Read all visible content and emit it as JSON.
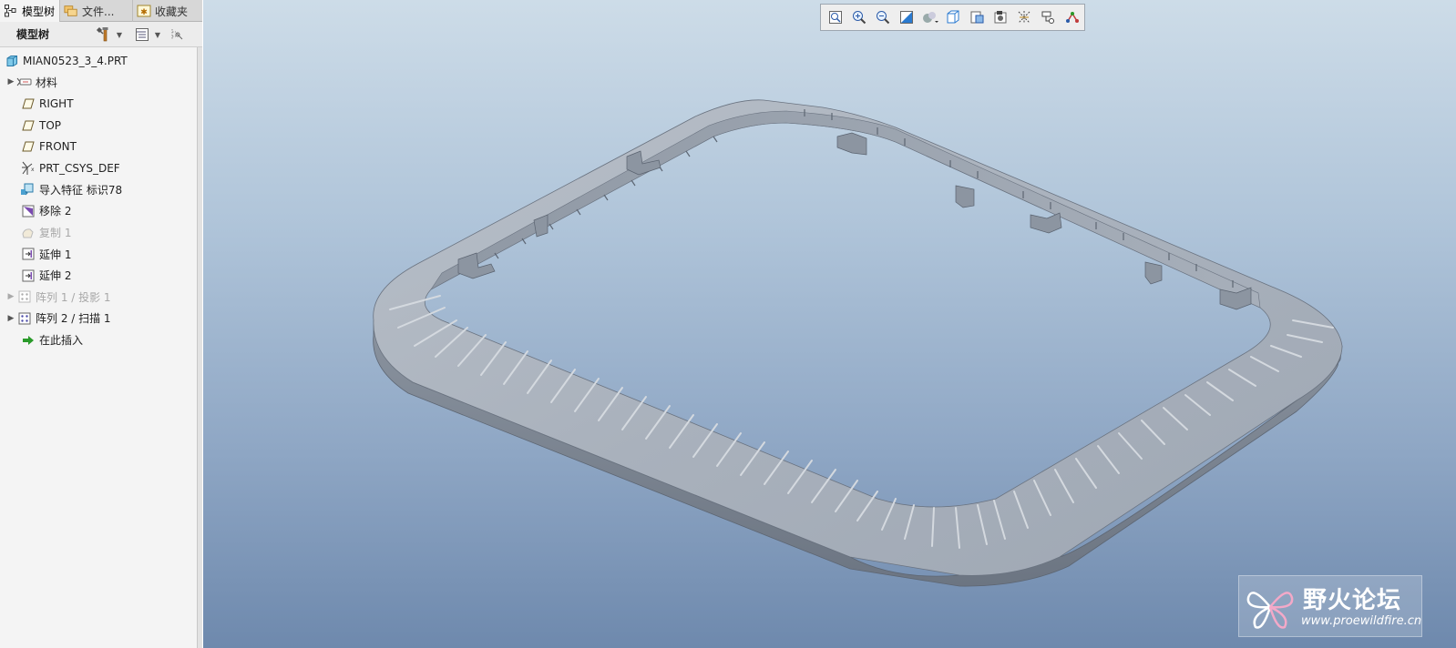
{
  "tabs": [
    {
      "label": "模型树",
      "icon": "tree-icon",
      "active": true
    },
    {
      "label": "文件...",
      "icon": "folders-icon",
      "active": false
    },
    {
      "label": "收藏夹",
      "icon": "star-icon",
      "active": false
    }
  ],
  "tree_header": {
    "title": "模型树"
  },
  "tree": {
    "root": {
      "label": "MIAN0523_3_4.PRT",
      "icon": "part-icon"
    },
    "items": [
      {
        "label": "材料",
        "icon": "material-icon",
        "expandable": true,
        "disabled": false
      },
      {
        "label": "RIGHT",
        "icon": "datum-plane-icon",
        "expandable": false,
        "disabled": false
      },
      {
        "label": "TOP",
        "icon": "datum-plane-icon",
        "expandable": false,
        "disabled": false
      },
      {
        "label": "FRONT",
        "icon": "datum-plane-icon",
        "expandable": false,
        "disabled": false
      },
      {
        "label": "PRT_CSYS_DEF",
        "icon": "csys-icon",
        "expandable": false,
        "disabled": false
      },
      {
        "label": "导入特征 标识78",
        "icon": "import-feature-icon",
        "expandable": false,
        "disabled": false
      },
      {
        "label": "移除 2",
        "icon": "remove-icon",
        "expandable": false,
        "disabled": false
      },
      {
        "label": "复制 1",
        "icon": "copy-icon",
        "expandable": false,
        "disabled": true
      },
      {
        "label": "延伸 1",
        "icon": "extend-icon",
        "expandable": false,
        "disabled": false
      },
      {
        "label": "延伸 2",
        "icon": "extend-icon",
        "expandable": false,
        "disabled": false
      },
      {
        "label": "阵列 1 / 投影 1",
        "icon": "pattern-icon",
        "expandable": true,
        "disabled": true
      },
      {
        "label": "阵列 2 / 扫描 1",
        "icon": "pattern-icon",
        "expandable": true,
        "disabled": false
      },
      {
        "label": "在此插入",
        "icon": "insert-here-icon",
        "expandable": false,
        "disabled": false
      }
    ]
  },
  "view_toolbar": [
    "refit-icon",
    "zoom-in-icon",
    "zoom-out-icon",
    "repaint-icon",
    "display-style-icon",
    "saved-orientations-icon",
    "view-manager-icon",
    "named-views-icon",
    "datum-display-icon",
    "annotation-display-icon",
    "spin-center-icon"
  ],
  "watermark": {
    "text": "野火论坛",
    "url": "www.proewildfire.cn"
  },
  "colors": {
    "panel_bg": "#f4f4f4",
    "viewport_top": "#cddce8",
    "viewport_bottom": "#6e89ad",
    "model_gray": "#a9b0b9"
  }
}
